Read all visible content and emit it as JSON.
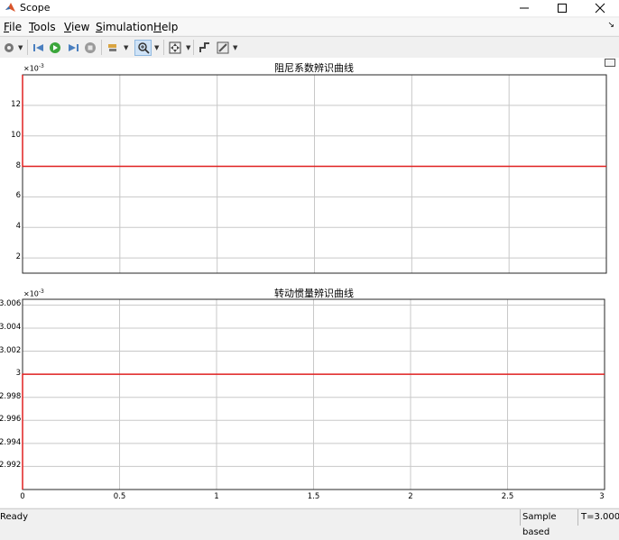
{
  "window": {
    "title": "Scope"
  },
  "menu": {
    "items": [
      {
        "label": "File",
        "u": "F",
        "rest": "ile"
      },
      {
        "label": "Tools",
        "u": "T",
        "rest": "ools"
      },
      {
        "label": "View",
        "u": "V",
        "rest": "iew"
      },
      {
        "label": "Simulation",
        "u": "S",
        "rest": "imulation"
      },
      {
        "label": "Help",
        "u": "H",
        "rest": "elp"
      }
    ]
  },
  "toolbar": {
    "icons": [
      "gear-icon",
      "step-back-icon",
      "run-icon",
      "step-forward-icon",
      "stop-icon",
      "highlight-icon",
      "zoom-icon",
      "autoscale-icon",
      "cursor-measure-icon",
      "style-icon"
    ],
    "active_tool": "zoom-icon"
  },
  "colors": {
    "trace": "#e02020",
    "grid": "#c8c8c8",
    "axes_bg": "#ffffff",
    "frame": "#262626"
  },
  "status": {
    "left": "Ready",
    "mode": "Sample based",
    "time": "T=3.000"
  },
  "chart_data": [
    {
      "type": "line",
      "title": "阻尼系数辨识曲线",
      "exponent_label": "×10",
      "exponent_power": "-3",
      "xlabel": "",
      "ylabel": "",
      "xlim": [
        0,
        3
      ],
      "ylim": [
        1,
        14
      ],
      "xticks": [
        0,
        0.5,
        1,
        1.5,
        2,
        2.5,
        3
      ],
      "yticks": [
        2,
        4,
        6,
        8,
        10,
        12
      ],
      "yticklabels": [
        "2",
        "4",
        "6",
        "8",
        "10",
        "12"
      ],
      "show_xtick_labels": false,
      "grid": true,
      "series": [
        {
          "x": [
            0,
            0,
            3
          ],
          "y": [
            14,
            8,
            8
          ]
        }
      ]
    },
    {
      "type": "line",
      "title": "转动惯量辨识曲线",
      "exponent_label": "×10",
      "exponent_power": "-3",
      "xlabel": "",
      "ylabel": "",
      "xlim": [
        0,
        3
      ],
      "ylim": [
        2.99,
        3.0065
      ],
      "xticks": [
        0,
        0.5,
        1,
        1.5,
        2,
        2.5,
        3
      ],
      "xticklabels": [
        "0",
        "0.5",
        "1",
        "1.5",
        "2",
        "2.5",
        "3"
      ],
      "yticks": [
        2.992,
        2.994,
        2.996,
        2.998,
        3.0,
        3.002,
        3.004,
        3.006
      ],
      "yticklabels": [
        "2.992",
        "2.994",
        "2.996",
        "2.998",
        "3",
        "3.002",
        "3.004",
        "3.006"
      ],
      "show_xtick_labels": true,
      "grid": true,
      "series": [
        {
          "x": [
            0,
            0,
            3
          ],
          "y": [
            2.99,
            3.0,
            3.0
          ]
        }
      ]
    }
  ]
}
